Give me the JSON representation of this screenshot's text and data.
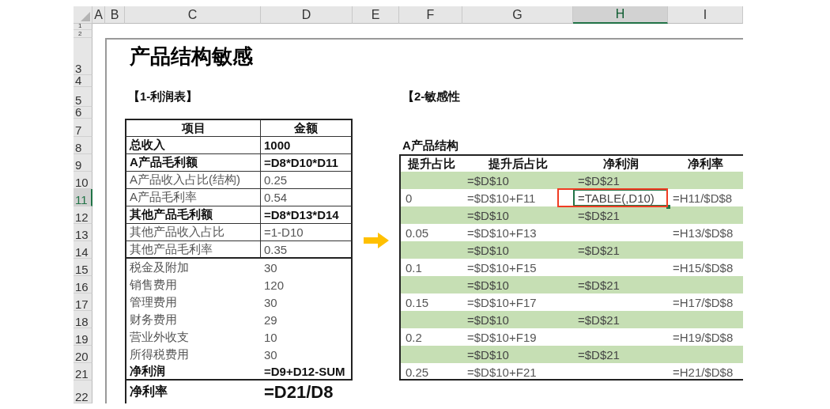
{
  "columns": [
    {
      "label": "A",
      "selected": false
    },
    {
      "label": "B",
      "selected": false
    },
    {
      "label": "C",
      "selected": false
    },
    {
      "label": "D",
      "selected": false
    },
    {
      "label": "E",
      "selected": false
    },
    {
      "label": "F",
      "selected": false
    },
    {
      "label": "G",
      "selected": false
    },
    {
      "label": "H",
      "selected": true
    },
    {
      "label": "I",
      "selected": false
    }
  ],
  "rows": [
    {
      "label": "1",
      "selected": false
    },
    {
      "label": "2",
      "selected": false
    },
    {
      "label": "3",
      "selected": false
    },
    {
      "label": "4",
      "selected": false
    },
    {
      "label": "5",
      "selected": false
    },
    {
      "label": "6",
      "selected": false
    },
    {
      "label": "7",
      "selected": false
    },
    {
      "label": "8",
      "selected": false
    },
    {
      "label": "9",
      "selected": false
    },
    {
      "label": "10",
      "selected": false
    },
    {
      "label": "11",
      "selected": true
    },
    {
      "label": "12",
      "selected": false
    },
    {
      "label": "13",
      "selected": false
    },
    {
      "label": "14",
      "selected": false
    },
    {
      "label": "15",
      "selected": false
    },
    {
      "label": "16",
      "selected": false
    },
    {
      "label": "17",
      "selected": false
    },
    {
      "label": "18",
      "selected": false
    },
    {
      "label": "19",
      "selected": false
    },
    {
      "label": "20",
      "selected": false
    },
    {
      "label": "21",
      "selected": false
    },
    {
      "label": "22",
      "selected": false
    }
  ],
  "title": "产品结构敏感",
  "section_1": "【1-利润表】",
  "section_2": "【2-敏感性",
  "profit_table": {
    "headers": [
      "项目",
      "金额"
    ],
    "rows": [
      {
        "item": "总收入",
        "amount": "1000",
        "bold": true
      },
      {
        "item": "A产品毛利额",
        "amount": "=D8*D10*D11",
        "bold": true
      },
      {
        "item": "A产品收入占比(结构)",
        "amount": "0.25",
        "bold": false
      },
      {
        "item": "A产品毛利率",
        "amount": "0.54",
        "bold": false
      },
      {
        "item": "其他产品毛利额",
        "amount": "=D8*D13*D14",
        "bold": true
      },
      {
        "item": "其他产品收入占比",
        "amount": "=1-D10",
        "bold": false
      },
      {
        "item": "其他产品毛利率",
        "amount": "0.35",
        "bold": false
      },
      {
        "item": "税金及附加",
        "amount": "30",
        "bold": false
      },
      {
        "item": "销售费用",
        "amount": "120",
        "bold": false
      },
      {
        "item": "管理费用",
        "amount": "30",
        "bold": false
      },
      {
        "item": "财务费用",
        "amount": "29",
        "bold": false
      },
      {
        "item": "营业外收支",
        "amount": "10",
        "bold": false
      },
      {
        "item": "所得税费用",
        "amount": "30",
        "bold": false
      },
      {
        "item": "净利润",
        "amount": "=D9+D12-SUM",
        "bold": true
      }
    ],
    "net_margin": {
      "item": "净利率",
      "amount": "=D21/D8"
    }
  },
  "sensitivity_table": {
    "caption": "A产品结构",
    "headers": [
      "提升占比",
      "提升后占比",
      "净利润",
      "净利率"
    ],
    "rows": [
      {
        "after": "=$D$10",
        "profit": "=$D$21",
        "shaded": true,
        "profit_selected": false
      },
      {
        "rise": "0",
        "after": "=$D$10+F11",
        "profit": "=TABLE(,D10)",
        "rate": "=H11/$D$8",
        "shaded": false,
        "profit_selected": true
      },
      {
        "after": "=$D$10",
        "profit": "=$D$21",
        "shaded": true,
        "profit_selected": false
      },
      {
        "rise": "0.05",
        "after": "=$D$10+F13",
        "rate": "=H13/$D$8",
        "shaded": false,
        "profit_selected": false
      },
      {
        "after": "=$D$10",
        "profit": "=$D$21",
        "shaded": true,
        "profit_selected": false
      },
      {
        "rise": "0.1",
        "after": "=$D$10+F15",
        "rate": "=H15/$D$8",
        "shaded": false,
        "profit_selected": false
      },
      {
        "after": "=$D$10",
        "profit": "=$D$21",
        "shaded": true,
        "profit_selected": false
      },
      {
        "rise": "0.15",
        "after": "=$D$10+F17",
        "rate": "=H17/$D$8",
        "shaded": false,
        "profit_selected": false
      },
      {
        "after": "=$D$10",
        "profit": "=$D$21",
        "shaded": true,
        "profit_selected": false
      },
      {
        "rise": "0.2",
        "after": "=$D$10+F19",
        "rate": "=H19/$D$8",
        "shaded": false,
        "profit_selected": false
      },
      {
        "after": "=$D$10",
        "profit": "=$D$21",
        "shaded": true,
        "profit_selected": false
      },
      {
        "rise": "0.25",
        "after": "=$D$10+F21",
        "rate": "=H21/$D$8",
        "shaded": false,
        "profit_selected": false
      }
    ]
  }
}
